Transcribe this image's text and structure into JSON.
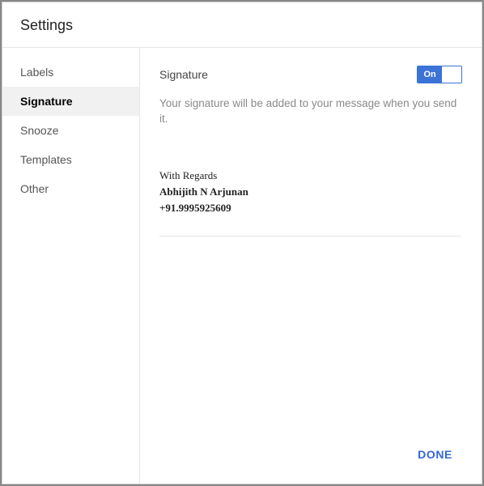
{
  "header": {
    "title": "Settings"
  },
  "sidebar": {
    "items": [
      {
        "label": "Labels"
      },
      {
        "label": "Signature"
      },
      {
        "label": "Snooze"
      },
      {
        "label": "Templates"
      },
      {
        "label": "Other"
      }
    ],
    "activeIndex": 1
  },
  "content": {
    "section_label": "Signature",
    "toggle_on_label": "On",
    "description": "Your signature will be added to your message when you send it.",
    "signature": {
      "line1": "With Regards",
      "line2": "Abhijith N Arjunan",
      "line3": "+91.9995925609"
    }
  },
  "footer": {
    "done_label": "DONE"
  }
}
